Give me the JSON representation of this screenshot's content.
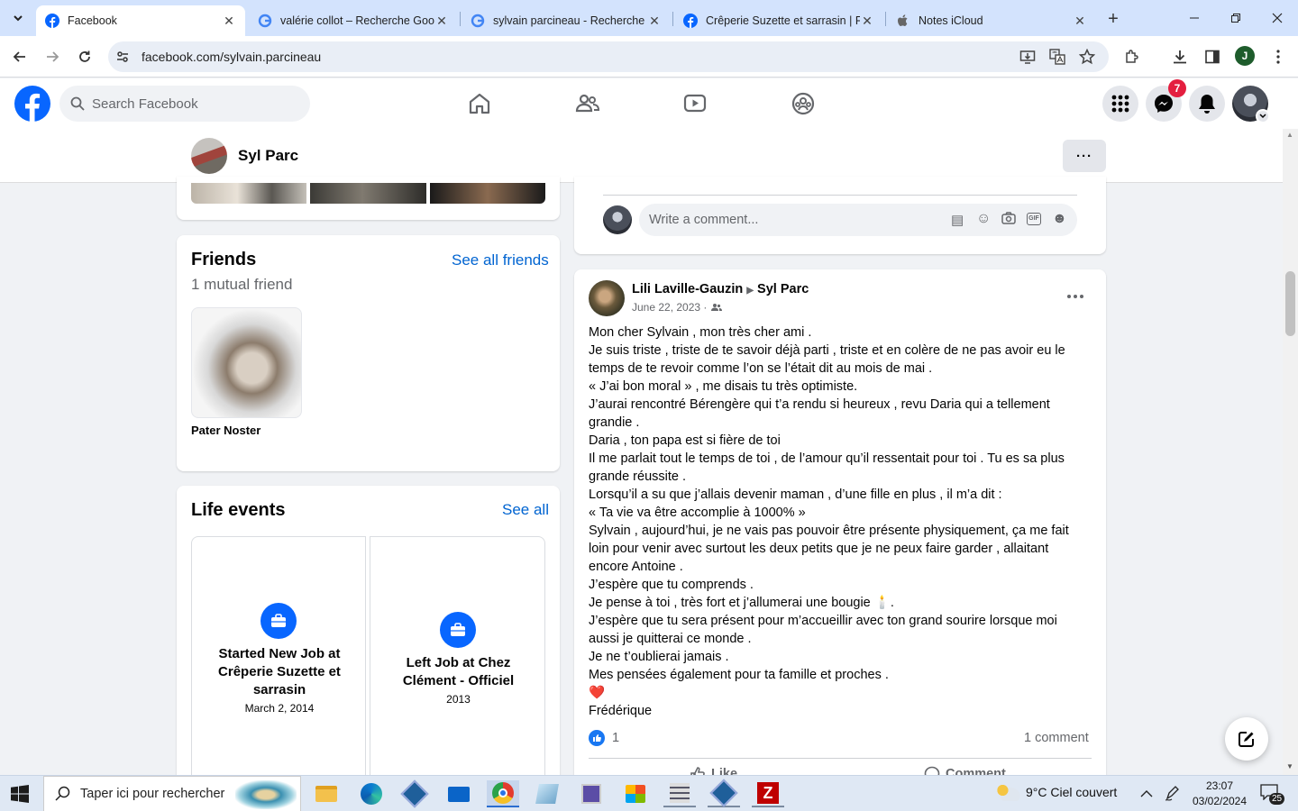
{
  "browser": {
    "tabs": [
      {
        "title": "Facebook",
        "active": true
      },
      {
        "title": "valérie collot – Recherche Goog",
        "active": false
      },
      {
        "title": "sylvain parcineau - Recherche G",
        "active": false
      },
      {
        "title": "Crêperie Suzette et sarrasin | Fa",
        "active": false
      },
      {
        "title": "Notes iCloud",
        "active": false
      }
    ],
    "url": "facebook.com/sylvain.parcineau",
    "profile_initial": "J"
  },
  "fb": {
    "search_placeholder": "Search Facebook",
    "messenger_badge": "7",
    "profile_name": "Syl Parc",
    "more_label": "···"
  },
  "friends": {
    "title": "Friends",
    "see_all": "See all friends",
    "mutual": "1 mutual friend",
    "items": [
      {
        "name": "Pater Noster"
      }
    ]
  },
  "life_events": {
    "title": "Life events",
    "see_all": "See all",
    "items": [
      {
        "title": "Started New Job at Crêperie Suzette et sarrasin",
        "date": "March 2, 2014"
      },
      {
        "title": "Left Job at Chez Clément - Officiel",
        "date": "2013"
      }
    ]
  },
  "comment_box": {
    "placeholder": "Write a comment..."
  },
  "post": {
    "author": "Lili Laville-Gauzin",
    "target": "Syl Parc",
    "date": "June 22, 2023 ·",
    "lines": [
      "Mon cher Sylvain , mon très cher ami .",
      "Je suis triste , triste de te savoir déjà parti , triste et en colère  de ne pas avoir eu le",
      "temps de te revoir comme l’on se l’était dit au mois de mai .",
      "« J’ai bon moral » , me disais tu très optimiste.",
      "J’aurai rencontré Bérengère qui t’a rendu si heureux , revu Daria qui a tellement",
      "grandie .",
      "Daria , ton papa est si fière de toi",
      "Il me parlait tout le temps de toi , de l’amour qu’il ressentait pour toi . Tu es sa plus",
      "grande réussite .",
      "Lorsqu’il a su que j’allais devenir maman , d’une fille en plus , il m’a dit :",
      "« Ta vie va être accomplie à 1000% »",
      " Sylvain , aujourd’hui, je ne vais pas pouvoir être présente physiquement, ça me fait",
      "loin pour venir avec surtout les deux petits que je ne peux faire garder , allaitant",
      "encore  Antoine .",
      "J’espère que tu comprends .",
      "Je pense à toi , très fort et j’allumerai une bougie 🕯️.",
      "J’espère que tu sera présent pour m’accueillir avec ton grand sourire lorsque moi",
      "aussi je quitterai ce monde .",
      "Je ne t’oublierai jamais .",
      "Mes pensées également pour ta famille et proches ."
    ],
    "heart": "❤️",
    "signature": "Frédérique",
    "like_count": "1",
    "comment_count": "1 comment",
    "like_label": "Like",
    "comment_label": "Comment"
  },
  "taskbar": {
    "search_placeholder": "Taper ici pour rechercher",
    "weather": "9°C  Ciel couvert",
    "time": "23:07",
    "date": "03/02/2024",
    "notif_count": "25"
  },
  "colors": {
    "fb_blue": "#0866ff",
    "link_blue": "#0064d1",
    "badge_red": "#e41e3f"
  }
}
